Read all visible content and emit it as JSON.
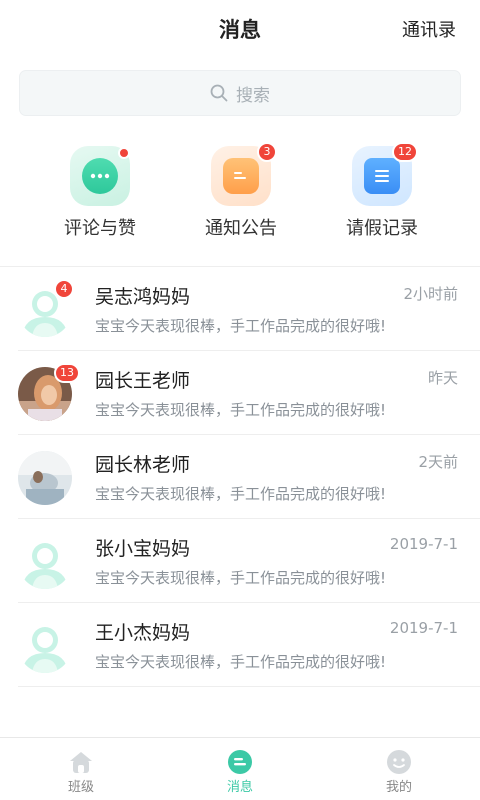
{
  "header": {
    "title": "消息",
    "contacts_label": "通讯录"
  },
  "search": {
    "placeholder": "搜索"
  },
  "quick_entries": [
    {
      "label": "评论与赞",
      "icon": "chat-bubble-icon",
      "badge": ""
    },
    {
      "label": "通知公告",
      "icon": "announcement-icon",
      "badge": "3"
    },
    {
      "label": "请假记录",
      "icon": "leave-record-icon",
      "badge": "12"
    }
  ],
  "conversations": [
    {
      "name": "吴志鸿妈妈",
      "time": "2小时前",
      "message": "宝宝今天表现很棒，手工作品完成的很好哦!",
      "badge": "4",
      "avatar": "default-avatar"
    },
    {
      "name": "园长王老师",
      "time": "昨天",
      "message": "宝宝今天表现很棒，手工作品完成的很好哦!",
      "badge": "13",
      "avatar": "photo-avatar"
    },
    {
      "name": "园长林老师",
      "time": "2天前",
      "message": "宝宝今天表现很棒，手工作品完成的很好哦!",
      "badge": "",
      "avatar": "photo-avatar"
    },
    {
      "name": "张小宝妈妈",
      "time": "2019-7-1",
      "message": "宝宝今天表现很棒，手工作品完成的很好哦!",
      "badge": "",
      "avatar": "default-avatar"
    },
    {
      "name": "王小杰妈妈",
      "time": "2019-7-1",
      "message": "宝宝今天表现很棒，手工作品完成的很好哦!",
      "badge": "",
      "avatar": "default-avatar"
    }
  ],
  "tabbar": {
    "tabs": [
      {
        "label": "班级",
        "icon": "class-house-icon",
        "active": false
      },
      {
        "label": "消息",
        "icon": "message-icon",
        "active": true
      },
      {
        "label": "我的",
        "icon": "profile-icon",
        "active": false
      }
    ]
  },
  "colors": {
    "accent": "#3cc9a6",
    "badge": "#f0453a",
    "text_primary": "#222222",
    "text_secondary": "#8a9198"
  }
}
